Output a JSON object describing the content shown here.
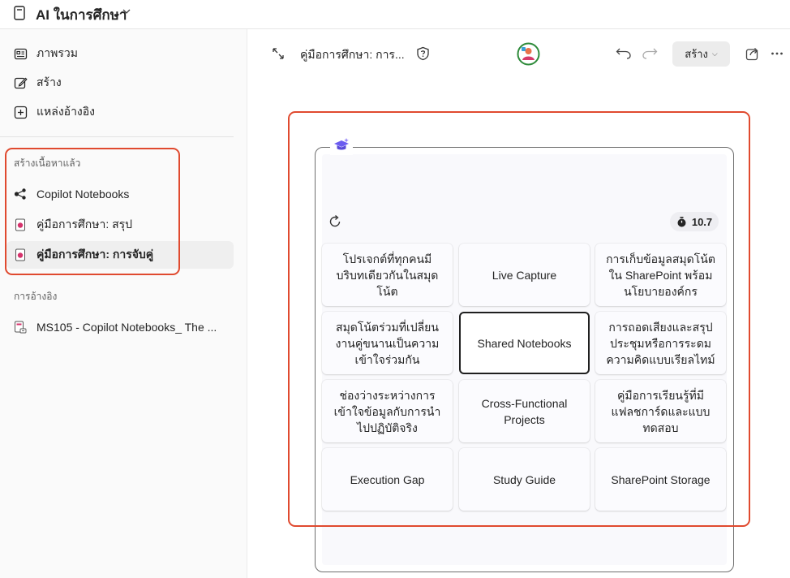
{
  "app": {
    "title": "AI ในการศึกษา"
  },
  "sidebar": {
    "nav": [
      {
        "label": "ภาพรวม",
        "icon": "overview-icon"
      },
      {
        "label": "สร้าง",
        "icon": "edit-icon"
      },
      {
        "label": "แหล่งอ้างอิง",
        "icon": "add-source-icon"
      }
    ],
    "created_section_label": "สร้างเนื้อหาแล้ว",
    "created_items": [
      {
        "label": "Copilot Notebooks",
        "icon": "share-graph-icon",
        "selected": false
      },
      {
        "label": "คู่มือการศึกษา: สรุป",
        "icon": "page-icon",
        "selected": false
      },
      {
        "label": "คู่มือการศึกษา: การจับคู่",
        "icon": "page-icon",
        "selected": true
      }
    ],
    "references_section_label": "การอ้างอิง",
    "references": [
      {
        "label": "MS105 - Copilot Notebooks_ The ...",
        "icon": "linked-file-icon"
      }
    ]
  },
  "toolbar": {
    "doc_title": "คู่มือการศึกษา: การ...",
    "create_label": "สร้าง"
  },
  "game": {
    "timer": "10.7",
    "tiles": [
      "โปรเจกต์ที่ทุกคนมีบริบทเดียวกันในสมุดโน้ต",
      "Live Capture",
      "การเก็บข้อมูลสมุดโน้ตใน SharePoint พร้อมนโยบายองค์กร",
      "สมุดโน้ตร่วมที่เปลี่ยนงานคู่ขนานเป็นความเข้าใจร่วมกัน",
      "Shared Notebooks",
      "การถอดเสียงและสรุปประชุมหรือการระดมความคิดแบบเรียลไทม์",
      "ช่องว่างระหว่างการเข้าใจข้อมูลกับการนำไปปฏิบัติจริง",
      "Cross-Functional Projects",
      "คู่มือการเรียนรู้ที่มีแฟลชการ์ดและแบบทดสอบ",
      "Execution Gap",
      "Study Guide",
      "SharePoint Storage"
    ],
    "active_tile_index": 4
  },
  "colors": {
    "highlight_box": "#e04a2f",
    "accent_purple": "#6b5cf0"
  }
}
